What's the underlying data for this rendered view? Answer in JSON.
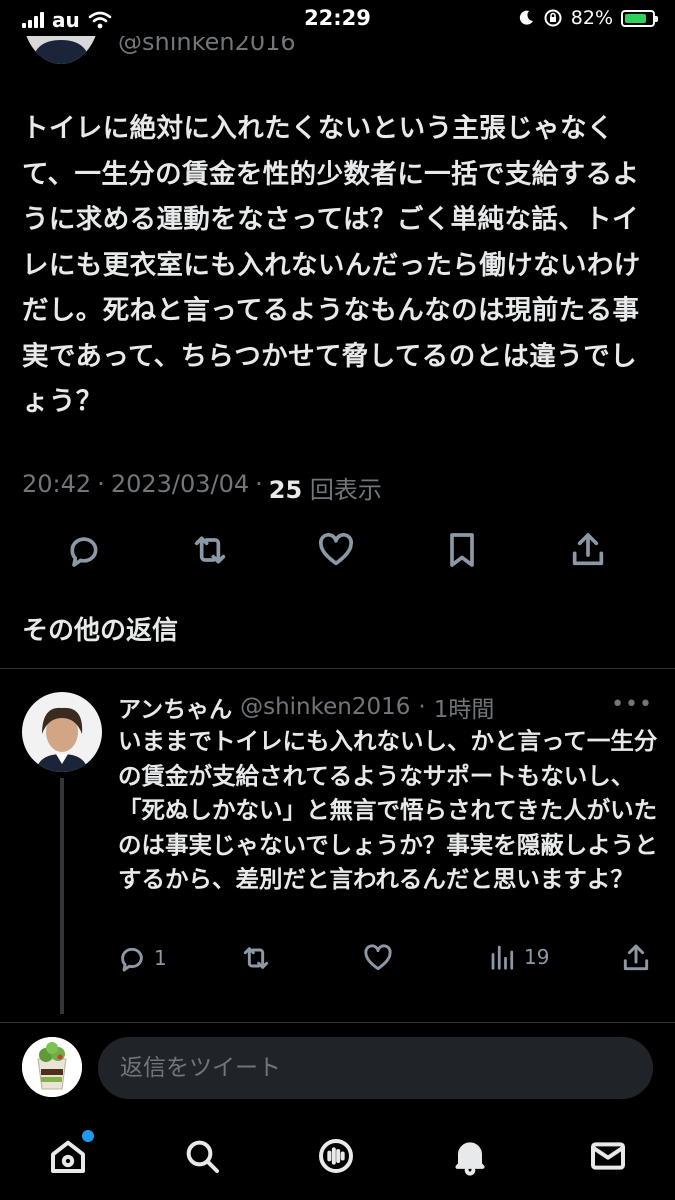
{
  "status_bar": {
    "carrier": "au",
    "time": "22:29",
    "battery": "82%",
    "battery_level": 0.82
  },
  "tweet": {
    "handle": "@shinken2016",
    "text": "トイレに絶対に入れたくないという主張じゃなくて、一生分の賃金を性的少数者に一括で支給するように求める運動をなさっては？ごく単純な話、トイレにも更衣室にも入れないんだったら働けないわけだし。死ねと言ってるようなもんなのは現前たる事実であって、ちらつかせて脅してるのとは違うでしょう？",
    "time": "20:42",
    "date": "2023/03/04",
    "views_count": "25",
    "views_label": "回表示",
    "separator": "·"
  },
  "section": {
    "title": "その他の返信"
  },
  "reply": {
    "name": "アンちゃん",
    "handle": "@shinken2016",
    "separator": "·",
    "time_ago": "1時間",
    "more": "•••",
    "text": "いままでトイレにも入れないし、かと言って一生分の賃金が支給されてるようなサポートもないし、「死ぬしかない」と無言で悟らされてきた人がいたのは事実じゃないでしょうか？事実を隠蔽しようとするから、差別だと言われるんだと思いますよ？",
    "reply_count": "1",
    "view_count": "19"
  },
  "compose": {
    "placeholder": "返信をツイート"
  },
  "colors": {
    "accent": "#1d9bf0",
    "muted": "#71767b",
    "text": "#e7e9ea"
  }
}
